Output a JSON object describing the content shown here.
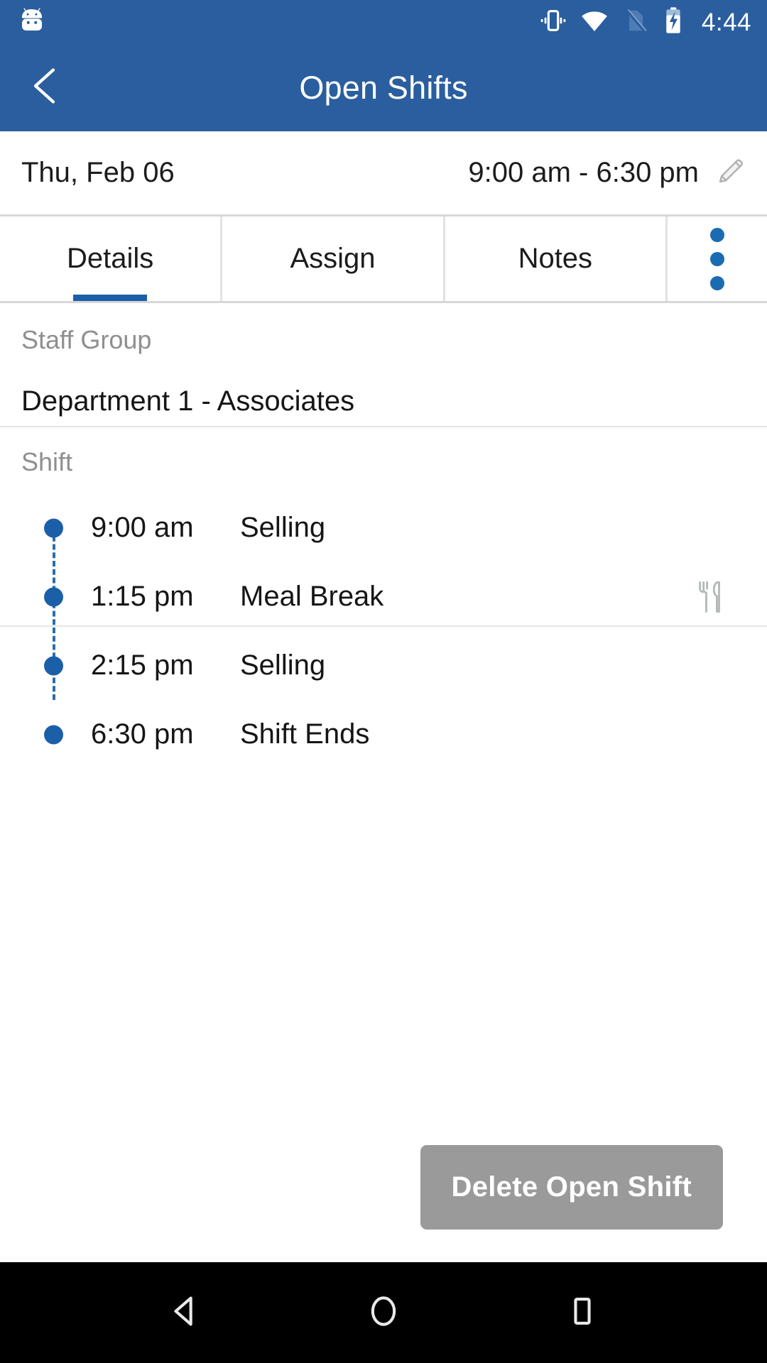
{
  "statusbar": {
    "time": "4:44",
    "icons": [
      {
        "name": "android-mascot-icon"
      },
      {
        "name": "vibrate-icon"
      },
      {
        "name": "wifi-icon"
      },
      {
        "name": "no-sim-icon"
      },
      {
        "name": "battery-charging-icon"
      }
    ]
  },
  "appbar": {
    "title": "Open Shifts",
    "back_icon": "back-chevron-icon"
  },
  "daterow": {
    "date": "Thu, Feb 06",
    "time_range": "9:00 am - 6:30 pm",
    "edit_icon": "pencil-icon"
  },
  "tabs": [
    {
      "label": "Details",
      "active": true
    },
    {
      "label": "Assign",
      "active": false
    },
    {
      "label": "Notes",
      "active": false
    }
  ],
  "overflow": {
    "icon": "more-vertical-icon"
  },
  "staff_group": {
    "label": "Staff Group",
    "value": "Department 1 - Associates"
  },
  "shift": {
    "label": "Shift",
    "entries": [
      {
        "time": "9:00 am",
        "activity": "Selling",
        "icon": ""
      },
      {
        "time": "1:15 pm",
        "activity": "Meal Break",
        "icon": "meal-icon"
      },
      {
        "time": "2:15 pm",
        "activity": "Selling",
        "icon": ""
      },
      {
        "time": "6:30 pm",
        "activity": "Shift Ends",
        "icon": ""
      }
    ]
  },
  "actions": {
    "delete_label": "Delete Open Shift"
  },
  "navbar": {
    "back": "nav-back-icon",
    "home": "nav-home-icon",
    "recents": "nav-recents-icon"
  },
  "colors": {
    "primary": "#2A5E9E",
    "accent": "#1B5FA8",
    "muted": "#8f8f8f",
    "button": "#9A9A9A"
  }
}
